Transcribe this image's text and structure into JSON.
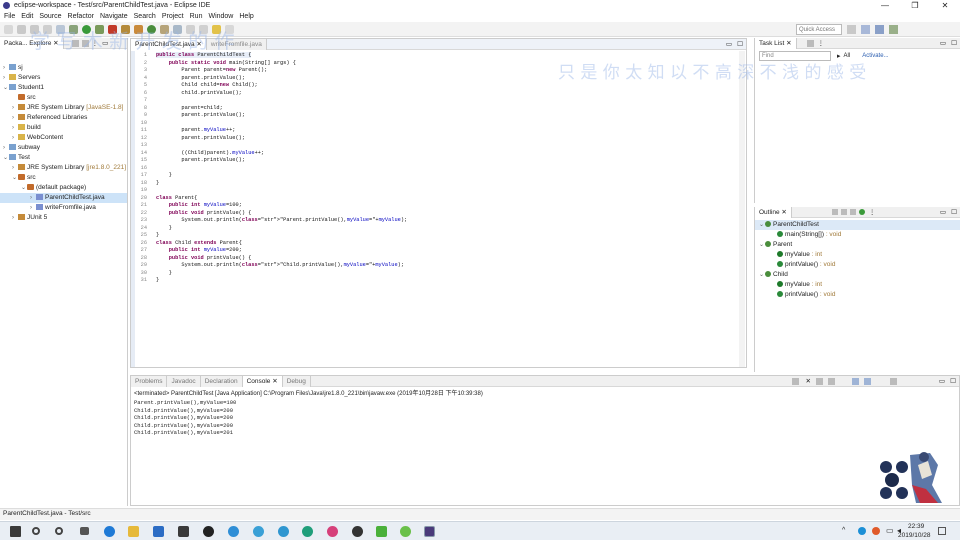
{
  "window": {
    "title": "eclipse-workspace - Test/src/ParentChildTest.java - Eclipse IDE",
    "controls": [
      "—",
      "❐",
      "✕"
    ]
  },
  "menu": [
    "File",
    "Edit",
    "Source",
    "Refactor",
    "Navigate",
    "Search",
    "Project",
    "Run",
    "Window",
    "Help"
  ],
  "toolbar": {
    "quick_access": "Quick Access"
  },
  "package_explorer": {
    "tab_label": "Packa... Explore",
    "tree": [
      {
        "indent": 0,
        "twisty": "›",
        "icon": "proj",
        "label": "sj",
        "deco": ""
      },
      {
        "indent": 0,
        "twisty": "›",
        "icon": "fold",
        "label": "Servers",
        "deco": ""
      },
      {
        "indent": 0,
        "twisty": "⌄",
        "icon": "proj",
        "label": "Student1",
        "deco": ""
      },
      {
        "indent": 1,
        "twisty": "",
        "icon": "pkg",
        "label": "src",
        "deco": ""
      },
      {
        "indent": 1,
        "twisty": "›",
        "icon": "lib",
        "label": "JRE System Library ",
        "deco": "[JavaSE-1.8]"
      },
      {
        "indent": 1,
        "twisty": "›",
        "icon": "lib",
        "label": "Referenced Libraries",
        "deco": ""
      },
      {
        "indent": 1,
        "twisty": "›",
        "icon": "fold",
        "label": "build",
        "deco": ""
      },
      {
        "indent": 1,
        "twisty": "›",
        "icon": "fold",
        "label": "WebContent",
        "deco": ""
      },
      {
        "indent": 0,
        "twisty": "›",
        "icon": "proj",
        "label": "subway",
        "deco": ""
      },
      {
        "indent": 0,
        "twisty": "⌄",
        "icon": "proj",
        "label": "Test",
        "deco": ""
      },
      {
        "indent": 1,
        "twisty": "›",
        "icon": "lib",
        "label": "JRE System Library ",
        "deco": "[jre1.8.0_221]"
      },
      {
        "indent": 1,
        "twisty": "⌄",
        "icon": "pkg",
        "label": "src",
        "deco": ""
      },
      {
        "indent": 2,
        "twisty": "⌄",
        "icon": "pkg",
        "label": "(default package)",
        "deco": ""
      },
      {
        "indent": 3,
        "twisty": "›",
        "icon": "jfile",
        "label": "ParentChildTest.java",
        "deco": "",
        "selected": true
      },
      {
        "indent": 3,
        "twisty": "›",
        "icon": "jfile",
        "label": "writeFromfile.java",
        "deco": ""
      },
      {
        "indent": 1,
        "twisty": "›",
        "icon": "lib",
        "label": "JUnit 5",
        "deco": ""
      }
    ]
  },
  "editor": {
    "tabs": [
      "ParentChildTest.java",
      "writeFromfile.java"
    ],
    "lines": [
      "public class ParentChildTest {",
      "    public static void main(String[] args) {",
      "        Parent parent=new Parent();",
      "        parent.printValue();",
      "        Child child=new Child();",
      "        child.printValue();",
      "",
      "        parent=child;",
      "        parent.printValue();",
      "",
      "        parent.myValue++;",
      "        parent.printValue();",
      "",
      "        ((Child)parent).myValue++;",
      "        parent.printValue();",
      "",
      "    }",
      "}",
      "",
      "class Parent{",
      "    public int myValue=100;",
      "    public void printValue() {",
      "        System.out.println(\"Parent.printValue(),myValue=\"+myValue);",
      "    }",
      "}",
      "class Child extends Parent{",
      "    public int myValue=200;",
      "    public void printValue() {",
      "        System.out.println(\"Child.printValue(),myValue=\"+myValue);",
      "    }",
      "}"
    ]
  },
  "task_list": {
    "tab_label": "Task List",
    "find_placeholder": "Find",
    "all": "All",
    "activate": "Activate..."
  },
  "outline": {
    "tab_label": "Outline",
    "items": [
      {
        "indent": 0,
        "twisty": "⌄",
        "label": "ParentChildTest",
        "type": "",
        "color": "#4a8d3c"
      },
      {
        "indent": 1,
        "twisty": "",
        "label": "main(String[])",
        "type": " : void",
        "color": "#2a8a3a"
      },
      {
        "indent": 0,
        "twisty": "⌄",
        "label": "Parent",
        "type": "",
        "color": "#4a8d3c"
      },
      {
        "indent": 1,
        "twisty": "",
        "label": "myValue",
        "type": " : int",
        "color": "#1e7a2a"
      },
      {
        "indent": 1,
        "twisty": "",
        "label": "printValue()",
        "type": " : void",
        "color": "#2a8a3a"
      },
      {
        "indent": 0,
        "twisty": "⌄",
        "label": "Child",
        "type": "",
        "color": "#4a8d3c"
      },
      {
        "indent": 1,
        "twisty": "",
        "label": "myValue",
        "type": " : int",
        "color": "#1e7a2a"
      },
      {
        "indent": 1,
        "twisty": "",
        "label": "printValue()",
        "type": " : void",
        "color": "#2a8a3a"
      }
    ]
  },
  "bottom_tabs": [
    "Problems",
    "Javadoc",
    "Declaration",
    "Console",
    "Debug"
  ],
  "console": {
    "header": "<terminated> ParentChildTest [Java Application] C:\\Program Files\\Java\\jre1.8.0_221\\bin\\javaw.exe (2019年10月28日 下午10:39:38)",
    "output": [
      "Parent.printValue(),myValue=100",
      "Child.printValue(),myValue=200",
      "Child.printValue(),myValue=200",
      "Child.printValue(),myValue=200",
      "Child.printValue(),myValue=201"
    ]
  },
  "status_bar": "ParentChildTest.java - Test/src",
  "taskbar": {
    "time": "22:39",
    "date": "2019/10/28"
  },
  "watermarks": [
    "学 写 木 新 开 发 的 作",
    "只 是 你 太 知 以 不 高 深 不 浅 的 感 受"
  ]
}
